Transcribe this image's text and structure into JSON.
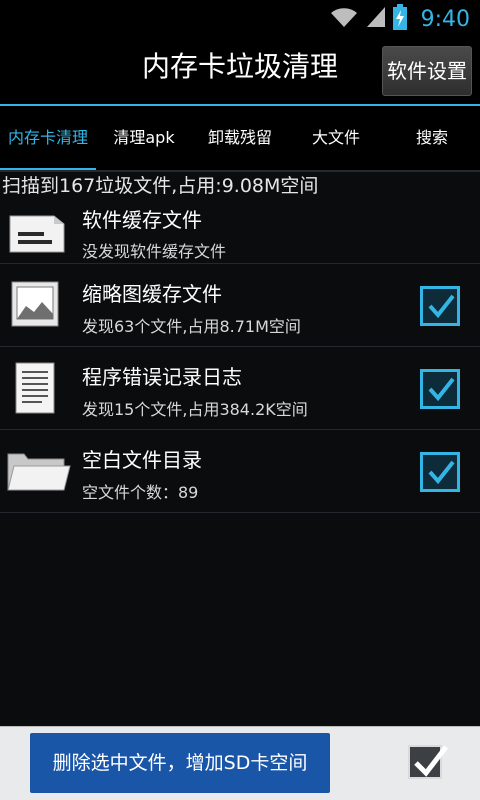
{
  "status": {
    "time": "9:40"
  },
  "title": "内存卡垃圾清理",
  "settings_button": "软件设置",
  "tabs": [
    {
      "label": "内存卡清理",
      "active": true
    },
    {
      "label": "清理apk"
    },
    {
      "label": "卸载残留"
    },
    {
      "label": "大文件"
    },
    {
      "label": "搜索"
    }
  ],
  "summary": "扫描到167垃圾文件,占用:9.08M空间",
  "items": [
    {
      "icon": "file-cache-icon",
      "title": "软件缓存文件",
      "subtitle": "没发现软件缓存文件",
      "checked": false,
      "show_checkbox": false
    },
    {
      "icon": "image-icon",
      "title": "缩略图缓存文件",
      "subtitle": "发现63个文件,占用8.71M空间",
      "checked": true,
      "show_checkbox": true
    },
    {
      "icon": "document-icon",
      "title": "程序错误记录日志",
      "subtitle": "发现15个文件,占用384.2K空间",
      "checked": true,
      "show_checkbox": true
    },
    {
      "icon": "folder-icon",
      "title": "空白文件目录",
      "subtitle": "空文件个数：89",
      "checked": true,
      "show_checkbox": true
    }
  ],
  "bottom": {
    "delete_button": "删除选中文件，增加SD卡空间",
    "select_all_checked": true
  },
  "colors": {
    "accent": "#33b5e5",
    "button_blue": "#1a56a8"
  }
}
